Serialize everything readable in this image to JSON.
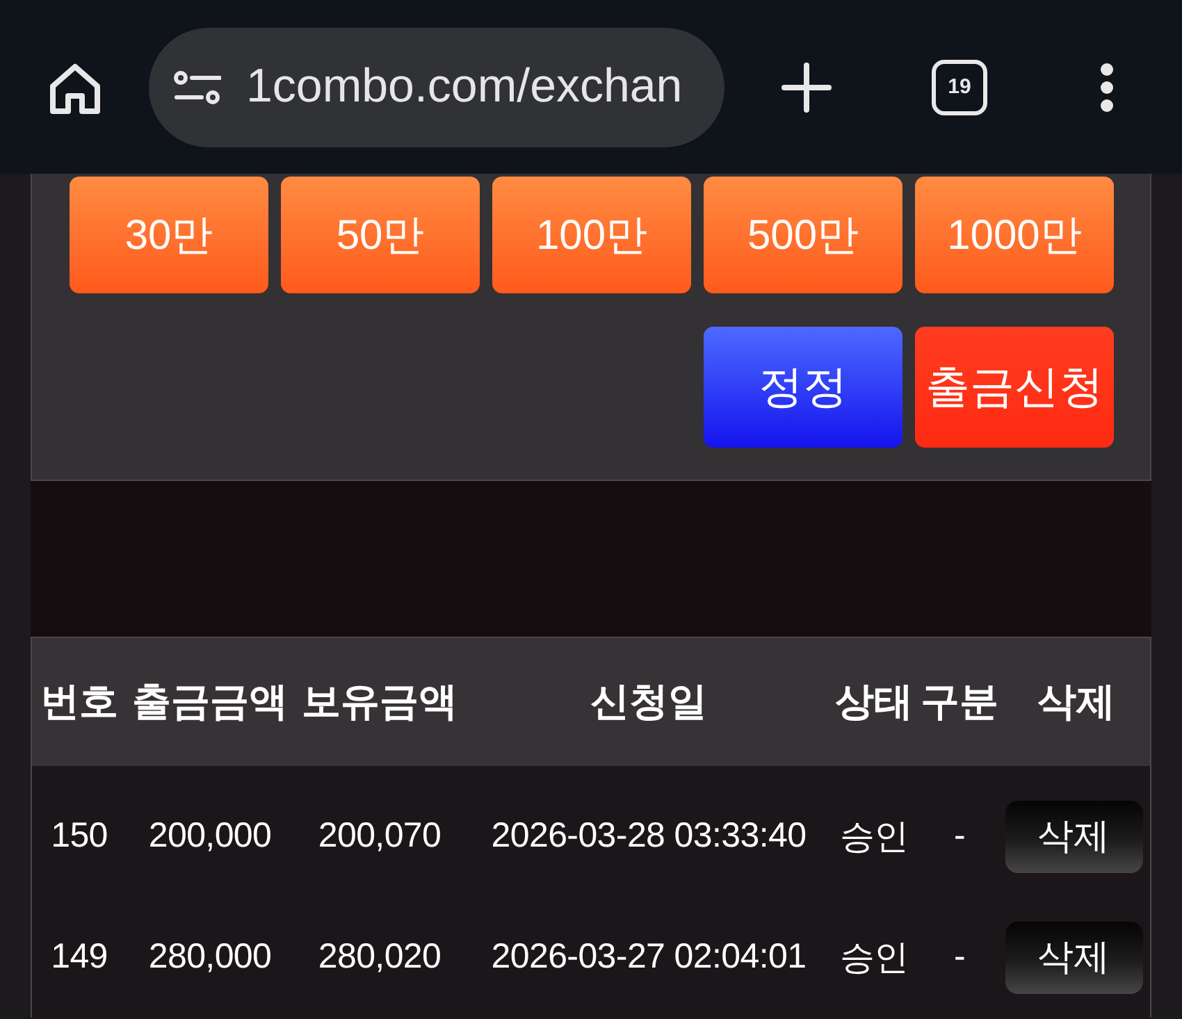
{
  "browser_bar": {
    "url": "1combo.com/exchan",
    "tab_count": "19"
  },
  "amount_buttons": [
    {
      "label": "30만"
    },
    {
      "label": "50만"
    },
    {
      "label": "100만"
    },
    {
      "label": "500만"
    },
    {
      "label": "1000만"
    }
  ],
  "actions": [
    {
      "kind": "correct",
      "label": "정정"
    },
    {
      "kind": "submit",
      "label": "출금신청"
    }
  ],
  "table": {
    "columns": [
      "번호",
      "출금금액",
      "보유금액",
      "신청일",
      "상태",
      "구분",
      "삭제"
    ],
    "rows": [
      {
        "cells": [
          "150",
          "200,000",
          "200,070",
          "2026-03-28 03:33:40",
          "승인",
          "-"
        ],
        "action": "삭제"
      },
      {
        "cells": [
          "149",
          "280,000",
          "280,020",
          "2026-03-27 02:04:01",
          "승인",
          "-"
        ],
        "action": "삭제"
      }
    ]
  }
}
